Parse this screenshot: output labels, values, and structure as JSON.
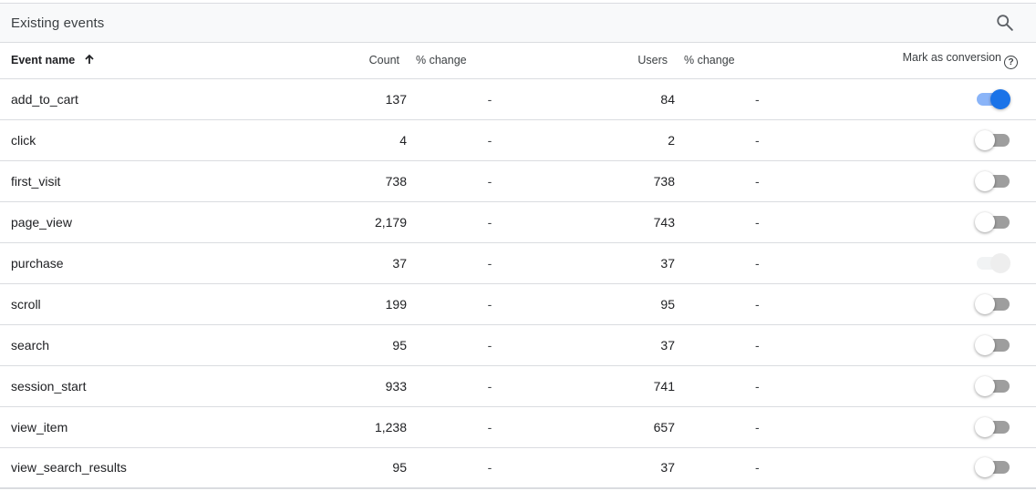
{
  "header": {
    "title": "Existing events",
    "search_icon": "search-icon"
  },
  "columns": {
    "event_name": "Event name",
    "sort_icon": "arrow-upward-icon",
    "count": "Count",
    "count_pct_change": "% change",
    "users": "Users",
    "users_pct_change": "% change",
    "mark_as_conversion": "Mark as conversion",
    "help_icon_label": "?"
  },
  "colors": {
    "accent": "#1a73e8",
    "track_on": "#8ab4f8",
    "track_off": "#9e9e9e",
    "border": "#dadce0",
    "header_bg": "#f8f9fa"
  },
  "rows": [
    {
      "name": "add_to_cart",
      "count": "137",
      "count_change": "-",
      "users": "84",
      "users_change": "-",
      "conversion": "on"
    },
    {
      "name": "click",
      "count": "4",
      "count_change": "-",
      "users": "2",
      "users_change": "-",
      "conversion": "off"
    },
    {
      "name": "first_visit",
      "count": "738",
      "count_change": "-",
      "users": "738",
      "users_change": "-",
      "conversion": "off"
    },
    {
      "name": "page_view",
      "count": "2,179",
      "count_change": "-",
      "users": "743",
      "users_change": "-",
      "conversion": "off"
    },
    {
      "name": "purchase",
      "count": "37",
      "count_change": "-",
      "users": "37",
      "users_change": "-",
      "conversion": "disabled"
    },
    {
      "name": "scroll",
      "count": "199",
      "count_change": "-",
      "users": "95",
      "users_change": "-",
      "conversion": "off"
    },
    {
      "name": "search",
      "count": "95",
      "count_change": "-",
      "users": "37",
      "users_change": "-",
      "conversion": "off"
    },
    {
      "name": "session_start",
      "count": "933",
      "count_change": "-",
      "users": "741",
      "users_change": "-",
      "conversion": "off"
    },
    {
      "name": "view_item",
      "count": "1,238",
      "count_change": "-",
      "users": "657",
      "users_change": "-",
      "conversion": "off"
    },
    {
      "name": "view_search_results",
      "count": "95",
      "count_change": "-",
      "users": "37",
      "users_change": "-",
      "conversion": "off"
    }
  ]
}
